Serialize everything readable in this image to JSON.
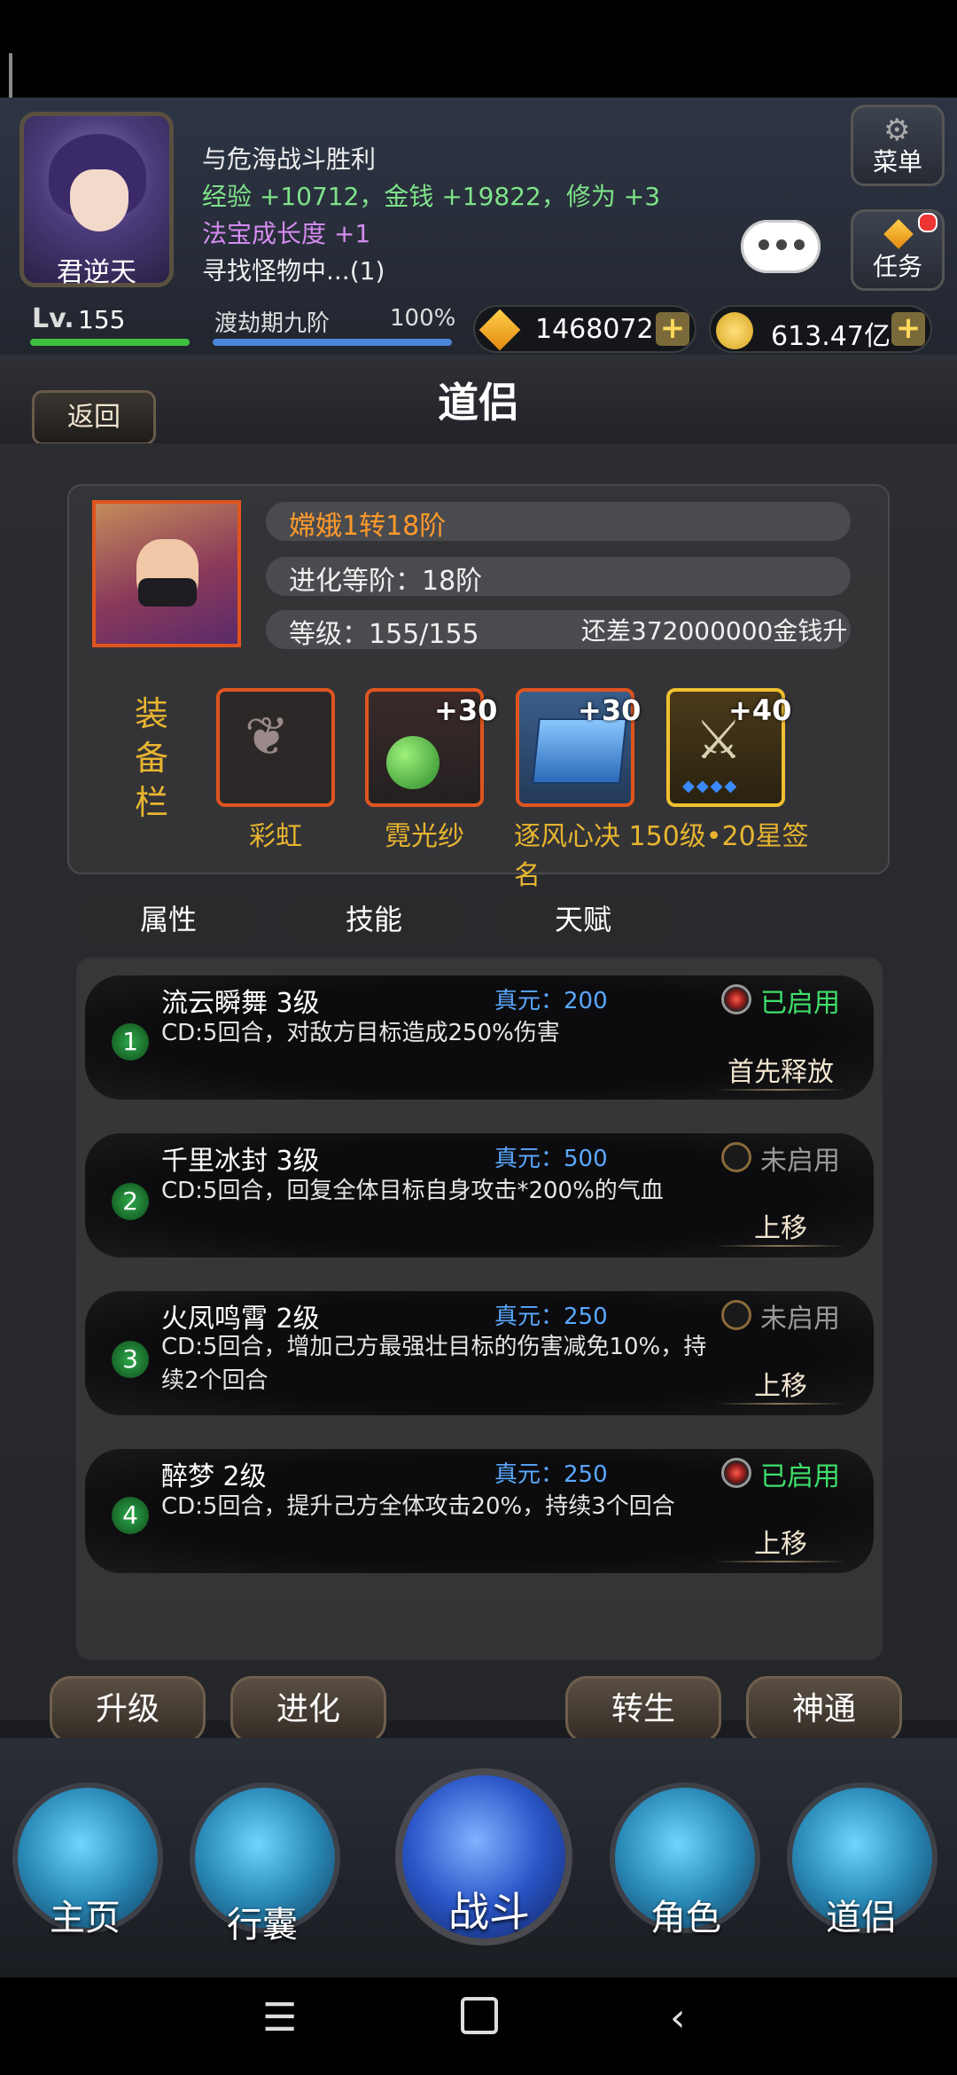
{
  "header": {
    "player_name": "君逆天",
    "log_lines": [
      "与危海战斗胜利",
      "经验 +10712，金钱 +19822，修为 +3",
      "法宝成长度 +1",
      "寻找怪物中...(1)"
    ],
    "menu_label": "菜单",
    "task_label": "任务",
    "level_label": "Lv.",
    "level_value": "155",
    "stage_label": "渡劫期九阶",
    "stage_percent": "100%",
    "gems": "1468072",
    "coins": "613.47亿",
    "plus": "+"
  },
  "page": {
    "back_label": "返回",
    "title": "道侣"
  },
  "companion": {
    "name": "嫦娥1转18阶",
    "evolve": "进化等阶：18阶",
    "level": "等级：155/155",
    "upgrade_cost": "还差372000000金钱升",
    "equip_label": "装备栏",
    "slots": [
      {
        "name": "彩虹",
        "plus": ""
      },
      {
        "name": "霓光纱",
        "plus": "+30"
      },
      {
        "name": "逐风心决 150级•20星签名",
        "plus": "+30"
      },
      {
        "name": "",
        "plus": "+40"
      }
    ]
  },
  "tabs": [
    "属性",
    "技能",
    "天赋"
  ],
  "skills": [
    {
      "num": "1",
      "title": "流云瞬舞 3级",
      "cost": "真元：200",
      "desc": "CD:5回合，对敌方目标造成250%伤害",
      "state": "已启用",
      "action": "首先释放"
    },
    {
      "num": "2",
      "title": "千里冰封 3级",
      "cost": "真元：500",
      "desc": "CD:5回合，回复全体目标自身攻击*200%的气血",
      "state": "未启用",
      "action": "上移"
    },
    {
      "num": "3",
      "title": "火凤鸣霄 2级",
      "cost": "真元：250",
      "desc": "CD:5回合，增加己方最强壮目标的伤害减免10%，持续2个回合",
      "state": "未启用",
      "action": "上移"
    },
    {
      "num": "4",
      "title": "醉梦 2级",
      "cost": "真元：250",
      "desc": "CD:5回合，提升己方全体攻击20%，持续3个回合",
      "state": "已启用",
      "action": "上移"
    }
  ],
  "actions": [
    "升级",
    "进化",
    "转生",
    "神通"
  ],
  "nav": [
    "主页",
    "行囊",
    "战斗",
    "角色",
    "道侣"
  ],
  "colors": {
    "accent_orange": "#ff9a2a",
    "gold_text": "#e8b530",
    "enabled_green": "#3fe06a",
    "cost_blue": "#5aa8ff"
  }
}
